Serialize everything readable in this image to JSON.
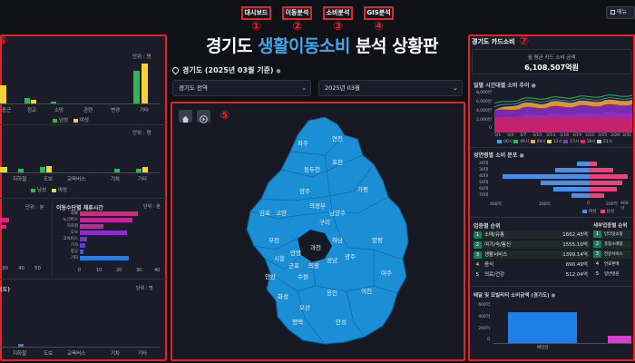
{
  "nav": {
    "dashboard": "대시보드",
    "mobility": "이동분석",
    "consumption": "소비분석",
    "gis": "GIS분석",
    "right_btn": "메뉴"
  },
  "markers": [
    "①",
    "②",
    "③",
    "④",
    "⑤",
    "⑥",
    "⑦"
  ],
  "title": {
    "part1": "경기도 ",
    "accent": "생활이동소비",
    "part2": " 분석 상황판"
  },
  "location": {
    "icon": "location-pin-icon",
    "text": "경기도 (2025년 03월 기준)",
    "info": "●"
  },
  "filters": {
    "region": "경기도 전역",
    "month": "2025년 03월"
  },
  "left": {
    "unit1": "단위 : 명",
    "xlabels1": [
      "종근",
      "정교",
      "소망",
      "관련",
      "변경",
      "기타"
    ],
    "legend1": [
      "남성",
      "여성"
    ],
    "unit2": "단위 : 명",
    "xlabels2": [
      "지하철",
      "도보",
      "교육버스",
      "기차",
      "기타"
    ],
    "legend2": [
      "남성",
      "여성"
    ],
    "card3_unit": "단위 : 분",
    "card3_axis": [
      "30",
      "40",
      "50"
    ],
    "card4_title": "이동수단별 체류시간",
    "card4_unit": "단위 : 분",
    "card4_labels": [
      "화물",
      "노선버스",
      "지하철",
      "도보",
      "고속버스",
      "기차",
      "항공",
      "기타"
    ],
    "card4_axis": [
      "0",
      "10",
      "20",
      "30",
      "40"
    ],
    "card5_title": "(도)",
    "card5_unit": "단위 : 명",
    "card5_xlabels": [
      "지하철",
      "도보",
      "교육버스",
      "기차",
      "기타"
    ]
  },
  "map": {
    "regions": [
      "파주",
      "연천",
      "동두천",
      "포천",
      "양주",
      "의정부",
      "가평",
      "남양주",
      "구리",
      "고양",
      "김포",
      "부천",
      "시흥",
      "안산",
      "화성",
      "오산",
      "수원",
      "용인",
      "안성",
      "평택",
      "이천",
      "여주",
      "양평",
      "광주",
      "하남",
      "성남",
      "과천",
      "안양",
      "군포",
      "의왕"
    ]
  },
  "right": {
    "card_title": "경기도 카드소비",
    "total_label": "월 평균 카드 소비 금액",
    "total_value": "6,108.507억원",
    "trend_title": "일별 시간대별 소비 추이",
    "trend_y": [
      "8,000만",
      "6,000만",
      "4,000만",
      "2,000만",
      "0"
    ],
    "trend_x": [
      "3/1",
      "3/4",
      "3/7",
      "3/10",
      "3/13",
      "3/16",
      "3/19",
      "3/22",
      "3/25",
      "3/28",
      "3/31"
    ],
    "trend_legend": [
      "00시",
      "06시",
      "09시",
      "12시",
      "15시",
      "18시",
      "21시"
    ],
    "age_title": "성연령별 소비 분포",
    "age_labels": [
      "20대",
      "30대",
      "40대",
      "50대",
      "60대",
      "70대"
    ],
    "age_axis": [
      "400억",
      "200억",
      "0",
      "200억",
      "400억"
    ],
    "age_legend": [
      "여성",
      "남성"
    ],
    "rank1_title": "업종별 순위",
    "rank1": [
      {
        "n": "1",
        "name": "소매/유통",
        "val": "1662.45억"
      },
      {
        "n": "2",
        "name": "여가/숙/통신",
        "val": "1555.10억"
      },
      {
        "n": "3",
        "name": "생활서비스",
        "val": "1399.14억"
      },
      {
        "n": "4",
        "name": "음식",
        "val": "690.49억"
      },
      {
        "n": "5",
        "name": "의료/건강",
        "val": "512.04억"
      }
    ],
    "rank2_title": "세부업종별 순위",
    "rank2": [
      {
        "n": "1",
        "name": "인터넷쇼핑"
      },
      {
        "n": "2",
        "name": "종합소매점"
      },
      {
        "n": "3",
        "name": "전문서비스"
      },
      {
        "n": "4",
        "name": "연료판매"
      },
      {
        "n": "5",
        "name": "일반병원"
      }
    ],
    "delivery_title": "배달 및 모빌리티 소비금액 (경기도)",
    "delivery_y": [
      "600억",
      "400억",
      "200억",
      "0"
    ],
    "delivery_x": [
      "배달업"
    ]
  }
}
